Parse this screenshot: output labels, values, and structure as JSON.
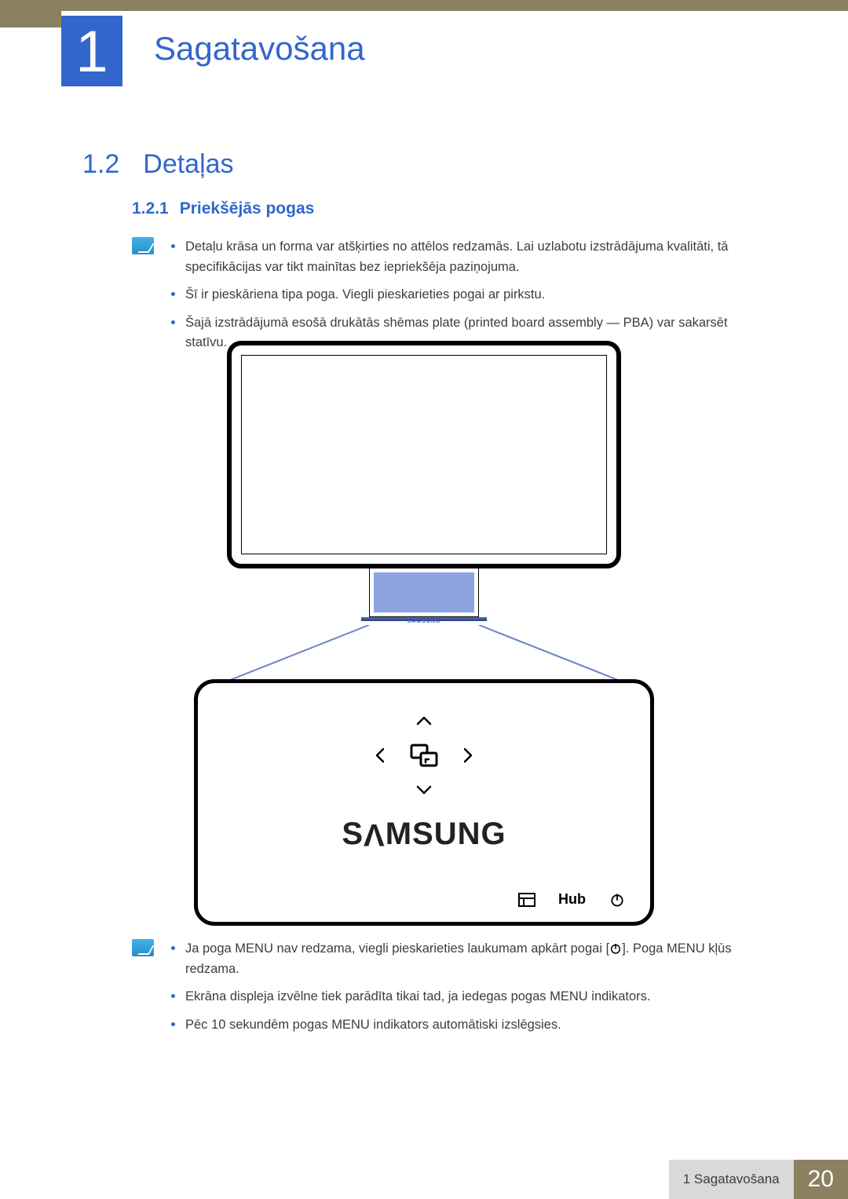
{
  "chapter": {
    "number": "1",
    "title": "Sagatavošana"
  },
  "section": {
    "number": "1.2",
    "title": "Detaļas"
  },
  "subsection": {
    "number": "1.2.1",
    "title": "Priekšējās pogas"
  },
  "note1": {
    "items": [
      "Detaļu krāsa un forma var atšķirties no attēlos redzamās. Lai uzlabotu izstrādājuma kvalitāti, tā specifikācijas var tikt mainītas bez iepriekšēja paziņojuma.",
      "Šī ir pieskāriena tipa poga. Viegli pieskarieties pogai ar pirkstu.",
      "Šajā izstrādājumā esošā drukātās shēmas plate (printed board assembly — PBA) var sakarsēt statīvu."
    ]
  },
  "figure": {
    "stand_brand": "SAMSUNG",
    "panel_brand_html": "SΛMSUNG",
    "buttons": {
      "up": "up-arrow",
      "down": "down-arrow",
      "left": "left-arrow",
      "right": "right-arrow",
      "center": "source-icon",
      "menu": "menu-icon",
      "hub_label": "Hub",
      "power": "power-icon"
    }
  },
  "note2": {
    "item1_pre": "Ja poga MENU nav redzama, viegli pieskarieties laukumam apkārt pogai [",
    "item1_post": "]. Poga MENU kļūs redzama.",
    "items_rest": [
      "Ekrāna displeja izvēlne tiek parādīta tikai tad, ja iedegas pogas MENU indikators.",
      "Pēc 10 sekundēm pogas MENU indikators automātiski izslēgsies."
    ]
  },
  "footer": {
    "label": "1 Sagatavošana",
    "page": "20"
  }
}
